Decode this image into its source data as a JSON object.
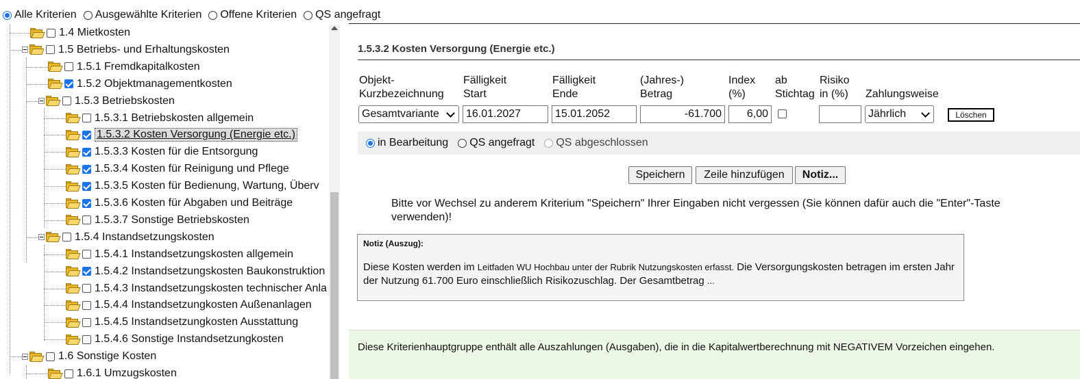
{
  "filters": [
    {
      "label": "Alle Kriterien",
      "checked": true
    },
    {
      "label": "Ausgewählte Kriterien",
      "checked": false
    },
    {
      "label": "Offene Kriterien",
      "checked": false
    },
    {
      "label": "QS angefragt",
      "checked": false
    }
  ],
  "tree": [
    {
      "label": "1.4 Mietkosten",
      "level": 1,
      "checked": false,
      "expanded": false
    },
    {
      "label": "1.5 Betriebs- und Erhaltungskosten",
      "level": 1,
      "checked": false,
      "expanded": true
    },
    {
      "label": "1.5.1 Fremdkapitalkosten",
      "level": 2,
      "checked": false,
      "expanded": false
    },
    {
      "label": "1.5.2 Objektmanagementkosten",
      "level": 2,
      "checked": true,
      "expanded": false
    },
    {
      "label": "1.5.3 Betriebskosten",
      "level": 2,
      "checked": false,
      "expanded": true
    },
    {
      "label": "1.5.3.1 Betriebskosten allgemein",
      "level": 3,
      "checked": false,
      "expanded": false
    },
    {
      "label": "1.5.3.2 Kosten Versorgung (Energie etc.)",
      "level": 3,
      "checked": true,
      "expanded": false,
      "selected": true
    },
    {
      "label": "1.5.3.3 Kosten für die Entsorgung",
      "level": 3,
      "checked": true,
      "expanded": false
    },
    {
      "label": "1.5.3.4 Kosten für Reinigung und Pflege",
      "level": 3,
      "checked": true,
      "expanded": false
    },
    {
      "label": "1.5.3.5 Kosten für Bedienung, Wartung, Überv",
      "level": 3,
      "checked": true,
      "expanded": false
    },
    {
      "label": "1.5.3.6 Kosten für Abgaben und Beiträge",
      "level": 3,
      "checked": true,
      "expanded": false
    },
    {
      "label": "1.5.3.7 Sonstige Betriebskosten",
      "level": 3,
      "checked": false,
      "expanded": false
    },
    {
      "label": "1.5.4 Instandsetzungskosten",
      "level": 2,
      "checked": false,
      "expanded": true
    },
    {
      "label": "1.5.4.1 Instandsetzungskosten allgemein",
      "level": 3,
      "checked": false,
      "expanded": false
    },
    {
      "label": "1.5.4.2 Instandsetzungskosten Baukonstruktion",
      "level": 3,
      "checked": true,
      "expanded": false
    },
    {
      "label": "1.5.4.3 Instandsetzungskosten technischer Anla",
      "level": 3,
      "checked": false,
      "expanded": false
    },
    {
      "label": "1.5.4.4 Instandsetzungkosten Außenanlagen",
      "level": 3,
      "checked": false,
      "expanded": false
    },
    {
      "label": "1.5.4.5 Instandsetzungkosten Ausstattung",
      "level": 3,
      "checked": false,
      "expanded": false
    },
    {
      "label": "1.5.4.6 Sonstige Instandsetzungkosten",
      "level": 3,
      "checked": false,
      "expanded": false
    },
    {
      "label": "1.6 Sonstige Kosten",
      "level": 1,
      "checked": false,
      "expanded": true
    },
    {
      "label": "1.6.1 Umzugskosten",
      "level": 2,
      "checked": false,
      "expanded": false
    }
  ],
  "detail": {
    "title": "1.5.3.2 Kosten Versorgung (Energie etc.)",
    "columns": {
      "objekt": [
        "Objekt-",
        "Kurzbezeichnung"
      ],
      "start": [
        "Fälligkeit",
        "Start"
      ],
      "ende": [
        "Fälligkeit",
        "Ende"
      ],
      "betrag": [
        "(Jahres-)",
        "Betrag"
      ],
      "index": [
        "Index",
        "(%)"
      ],
      "stichtag": [
        "ab",
        "Stichtag"
      ],
      "risiko": [
        "Risiko",
        "in (%)"
      ],
      "zahlung": [
        "",
        "Zahlungsweise"
      ]
    },
    "row": {
      "objekt": "Gesamtvariante",
      "start": "16.01.2027",
      "ende": "15.01.2052",
      "betrag": "-61.700",
      "index": "6,00",
      "stichtag_checked": false,
      "risiko": "",
      "zahlung": "Jährlich",
      "delete_label": "Löschen"
    },
    "status": [
      {
        "label": "in Bearbeitung",
        "checked": true,
        "disabled": false
      },
      {
        "label": "QS angefragt",
        "checked": false,
        "disabled": false
      },
      {
        "label": "QS abgeschlossen",
        "checked": false,
        "disabled": true
      }
    ],
    "buttons": {
      "save": "Speichern",
      "add_row": "Zeile hinzufügen",
      "note": "Notiz..."
    },
    "hint": "Bitte vor Wechsel zu anderem Kriterium \"Speichern\" Ihrer Eingaben nicht vergessen (Sie können dafür auch die \"Enter\"-Taste verwenden)!",
    "note": {
      "title": "Notiz (Auszug):",
      "text_a": "Diese Kosten werden im ",
      "text_b": "Leitfaden WU Hochbau unter der Rubrik Nutzungskosten erfasst.",
      "text_c": " Die Versorgungskosten betragen im ersten Jahr der Nutzung 61.700 Euro einschließlich Risikozuschlag. Der Gesamtbetrag ",
      "text_d": "..."
    },
    "footer": "Diese Kriterienhauptgruppe enthält alle Auszahlungen (Ausgaben), die in die Kapitalwertberechnung mit NEGATIVEM Vorzeichen eingehen."
  },
  "colors": {
    "accent": "#1a73e8",
    "footer_bg": "#edf7e6",
    "folder": "#e8b82a"
  }
}
